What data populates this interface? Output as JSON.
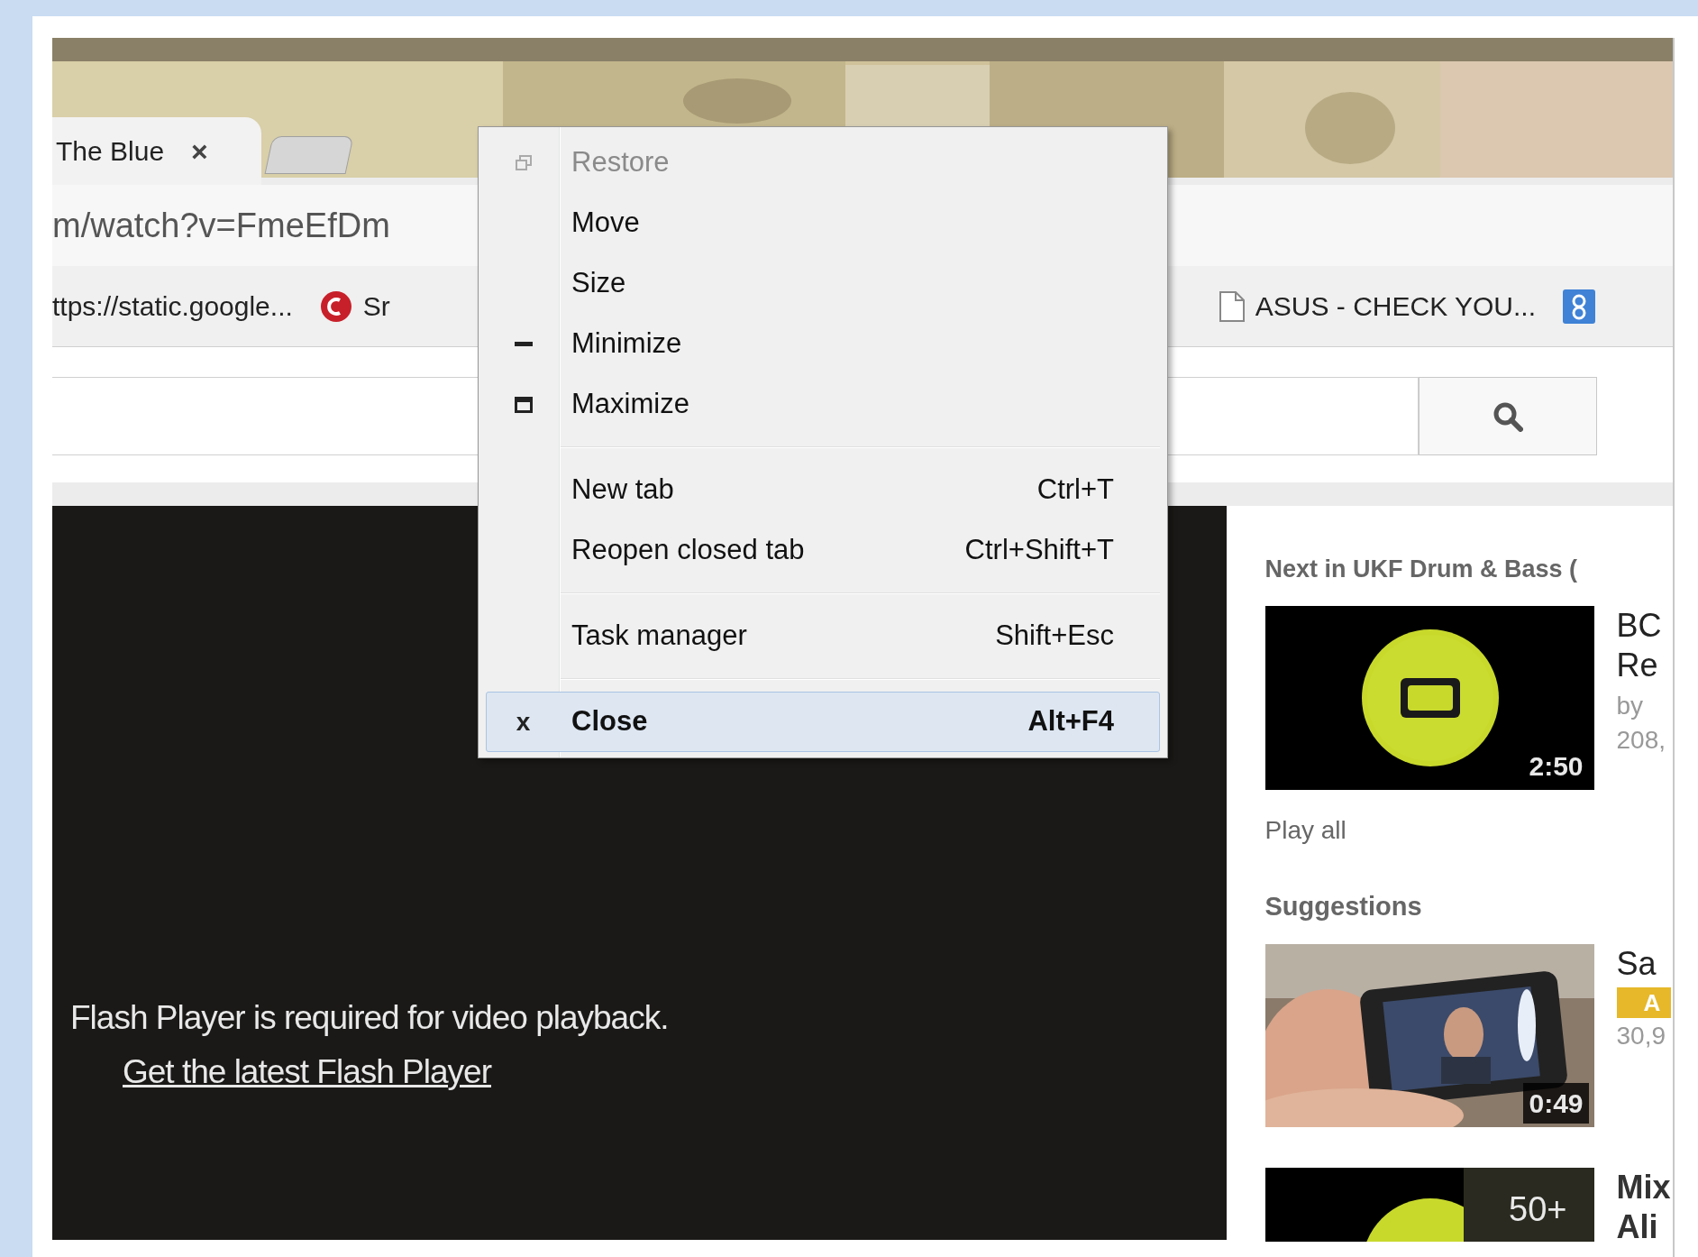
{
  "tab": {
    "title": "The Blue",
    "close": "×"
  },
  "address": {
    "value": "m/watch?v=FmeEfDm"
  },
  "bookmarks": [
    {
      "kind": "text",
      "label": "ttps://static.google..."
    },
    {
      "kind": "red",
      "label": "Sr"
    },
    {
      "kind": "page",
      "label": "ASUS - CHECK YOU..."
    },
    {
      "kind": "blue"
    }
  ],
  "player": {
    "message": "Flash Player is required for video playback.",
    "link": "Get the latest Flash Player"
  },
  "sidebar": {
    "playlist_heading": "Next in UKF Drum & Bass (",
    "playlist_item": {
      "kind": "logo",
      "duration": "2:50",
      "lines": [
        "BC",
        "Re",
        "by",
        "208,"
      ]
    },
    "play_all": "Play all",
    "suggestions_heading": "Suggestions",
    "suggestions": [
      {
        "duration": "0:49",
        "lines": [
          "Sa"
        ],
        "badge": "A",
        "views": "30,9"
      },
      {
        "kind": "playlist",
        "count": "50+",
        "lines": [
          "Mix",
          "Ali"
        ]
      }
    ]
  },
  "menu": [
    {
      "kind": "restore",
      "label": "Restore",
      "disabled": true,
      "selected": false
    },
    {
      "kind": "plain",
      "label": "Move",
      "disabled": false,
      "selected": false
    },
    {
      "kind": "plain",
      "label": "Size",
      "disabled": false,
      "selected": false
    },
    {
      "kind": "minimize",
      "label": "Minimize",
      "disabled": false,
      "selected": false
    },
    {
      "kind": "maximize",
      "label": "Maximize",
      "disabled": false,
      "selected": false
    },
    {
      "kind": "separator"
    },
    {
      "kind": "plain",
      "label": "New tab",
      "shortcut": "Ctrl+T",
      "disabled": false,
      "selected": false
    },
    {
      "kind": "plain",
      "label": "Reopen closed tab",
      "shortcut": "Ctrl+Shift+T",
      "disabled": false,
      "selected": false
    },
    {
      "kind": "separator"
    },
    {
      "kind": "plain",
      "label": "Task manager",
      "shortcut": "Shift+Esc",
      "disabled": false,
      "selected": false
    },
    {
      "kind": "separator"
    },
    {
      "kind": "glyph",
      "glyph": "x",
      "label": "Close",
      "shortcut": "Alt+F4",
      "disabled": false,
      "selected": true
    }
  ]
}
